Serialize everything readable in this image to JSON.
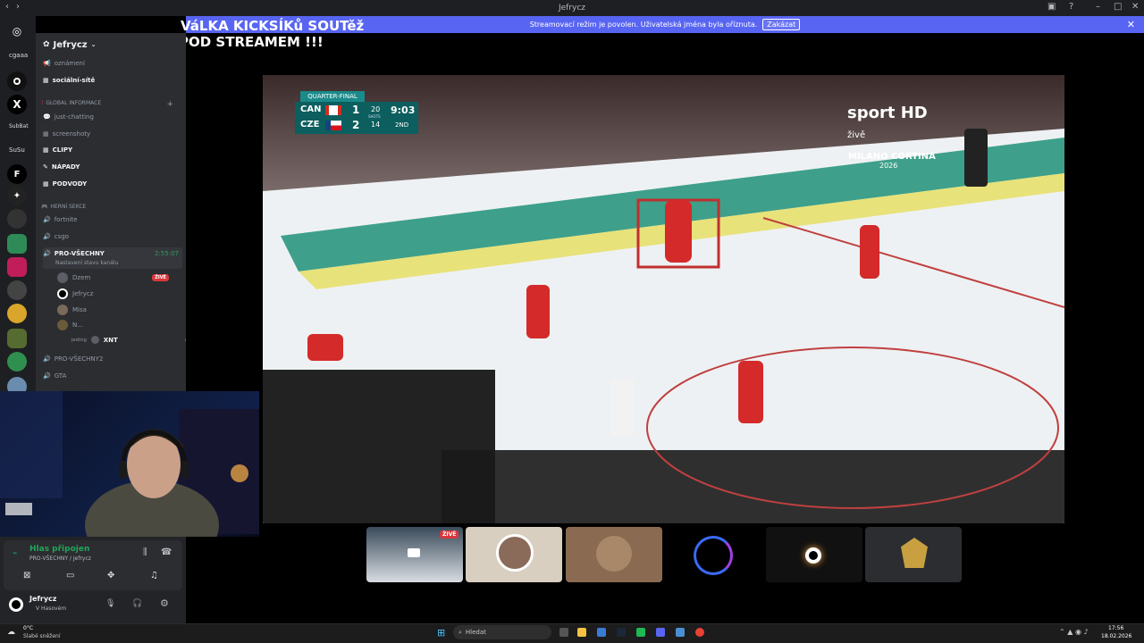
{
  "window": {
    "title": "Jefrycz"
  },
  "notice": {
    "text": "Streamovací režim je povolen. Uživatelská jména byla oříznuta.",
    "button": "Zakázat"
  },
  "stream_overlay": {
    "line1": "VáLKA KICKSÍKů SOUTěž",
    "line2": "POD STREAMEM !!!"
  },
  "rail": {
    "label1": "cgaaa",
    "label2": "SubBat",
    "label3": "SuSu"
  },
  "server": {
    "name": "Jefrycz"
  },
  "channels": [
    {
      "label": "oznámení",
      "bold": false
    },
    {
      "label": "sociální-sítě",
      "bold": true
    }
  ],
  "category_global": "GLOBAL INFORMACE",
  "channels_global": [
    {
      "label": "just-chatting",
      "bold": false
    },
    {
      "label": "screenshoty",
      "bold": false
    },
    {
      "label": "CLIPY",
      "bold": true
    },
    {
      "label": "NÁPADY",
      "bold": true
    },
    {
      "label": "PODVODY",
      "bold": true
    }
  ],
  "category_games": "HERNÍ SEKCE",
  "channels_games": [
    {
      "label": "fortnite"
    },
    {
      "label": "csgo"
    }
  ],
  "voice_channel": {
    "label": "PRO-VŠECHNY",
    "time": "2:55:07",
    "status": "Nastavení stavu kanálu",
    "users": [
      {
        "name": "Dzem",
        "live": "ŽIVĚ"
      },
      {
        "name": "Jefrycz"
      },
      {
        "name": "Misa"
      },
      {
        "name": "N..."
      }
    ],
    "sub_user_prefix": "jesting",
    "sub_user_name": "XNT"
  },
  "voice_channel2": {
    "label": "PRO-VŠECHNY2"
  },
  "voice_channel3": {
    "label": "GTA"
  },
  "voice_panel": {
    "status": "Hlas připojen",
    "channel": "PRO-VŠECHNY / Jefrycz",
    "user": "Jefrycz",
    "user_status": "V Hasovém"
  },
  "scoreboard": {
    "stage": "QUARTER-FINAL",
    "team1": "CAN",
    "score1": "1",
    "shots1": "20",
    "team2": "CZE",
    "score2": "2",
    "shots2": "14",
    "shots_label": "SHOTS",
    "time": "9:03",
    "period": "2ND"
  },
  "broadcast": {
    "logo": "sport HD",
    "logo_sub": "živě",
    "event": "MILANO CORTINA",
    "event_year": "2026"
  },
  "thumbnails": [
    {
      "badge": "ŽIVĚ"
    }
  ],
  "taskbar": {
    "weather_temp": "0°C",
    "weather_desc": "Slabé sněžení",
    "search": "Hledat",
    "time": "17:56",
    "date": "18.02.2026"
  },
  "colors": {
    "blurple": "#5865f2",
    "sidebar": "#2b2d31",
    "rail": "#1e1f22",
    "live": "#da373c",
    "green": "#23a55a"
  }
}
